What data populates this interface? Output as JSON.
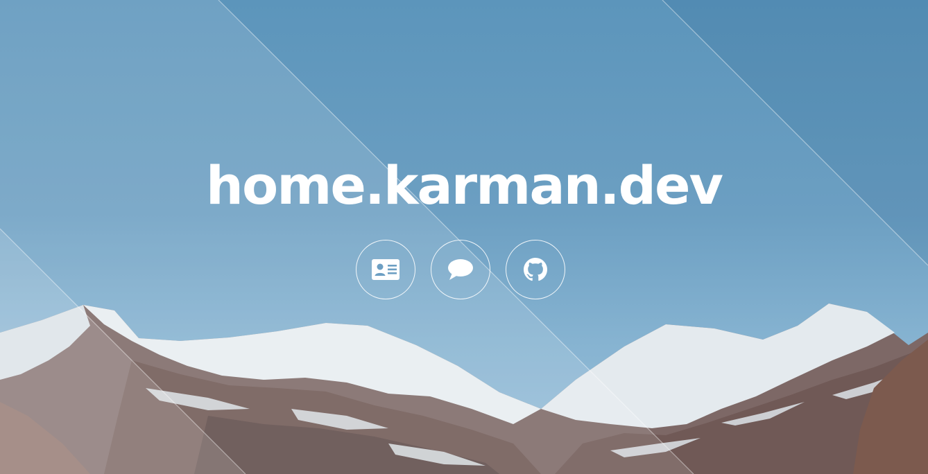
{
  "site": {
    "title": "home.karman.dev"
  },
  "links": [
    {
      "name": "contact-card",
      "icon": "id-card-icon"
    },
    {
      "name": "chat",
      "icon": "speech-bubble-icon"
    },
    {
      "name": "github",
      "icon": "github-icon"
    }
  ],
  "colors": {
    "sky_top": "#5c95bb",
    "sky_bottom": "#9cc1da",
    "text": "#ffffff",
    "snow": "#e9eef2",
    "rock": "#6b5450"
  }
}
